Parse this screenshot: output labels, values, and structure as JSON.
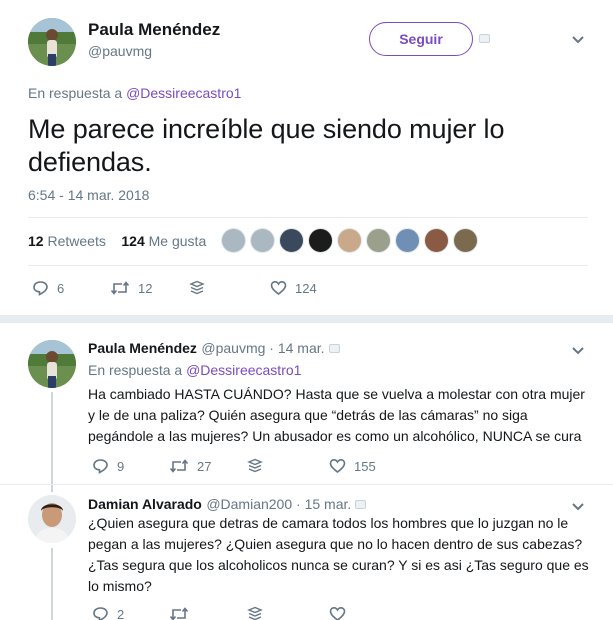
{
  "main_tweet": {
    "author_name": "Paula Menéndez",
    "author_handle": "@pauvmg",
    "follow_label": "Seguir",
    "reply_prefix": "En respuesta a",
    "reply_to": "@Dessireecastro1",
    "text": "Me parece increíble que siendo mujer lo defiendas.",
    "timestamp": "6:54 - 14 mar. 2018",
    "retweets_count": "12",
    "retweets_label": "Retweets",
    "likes_count": "124",
    "likes_label": "Me gusta",
    "actions": {
      "replies": "6",
      "retweets": "12",
      "likes": "124"
    }
  },
  "replies": [
    {
      "author_name": "Paula Menéndez",
      "author_handle": "@pauvmg · 14 mar.",
      "reply_prefix": "En respuesta a",
      "reply_to": "@Dessireecastro1",
      "text": "Ha cambiado HASTA CUÁNDO? Hasta que se vuelva a molestar con otra mujer y le de una paliza? Quién asegura que “detrás de las cámaras” no siga pegándole a las mujeres? Un abusador es como un alcohólico, NUNCA se cura",
      "actions": {
        "replies": "9",
        "retweets": "27",
        "likes": "155"
      }
    },
    {
      "author_name": "Damian Alvarado",
      "author_handle": "@Damian200 · 15 mar.",
      "text": "¿Quien asegura que detras de camara todos los hombres que lo juzgan no le pegan a las mujeres? ¿Quien asegura que no lo hacen dentro de sus cabezas? ¿Tas segura que los alcoholicos nunca se curan? Y si es asi ¿Tas seguro que es lo mismo?",
      "actions": {
        "replies": "2"
      }
    }
  ],
  "colors": {
    "accent": "#794bc4",
    "text_primary": "#14171a",
    "text_secondary": "#657786",
    "divider": "#e6ecf0"
  },
  "icons": [
    "reply-icon",
    "retweet-icon",
    "direct-message-icon",
    "like-icon",
    "chevron-down-icon",
    "flag-icon"
  ]
}
